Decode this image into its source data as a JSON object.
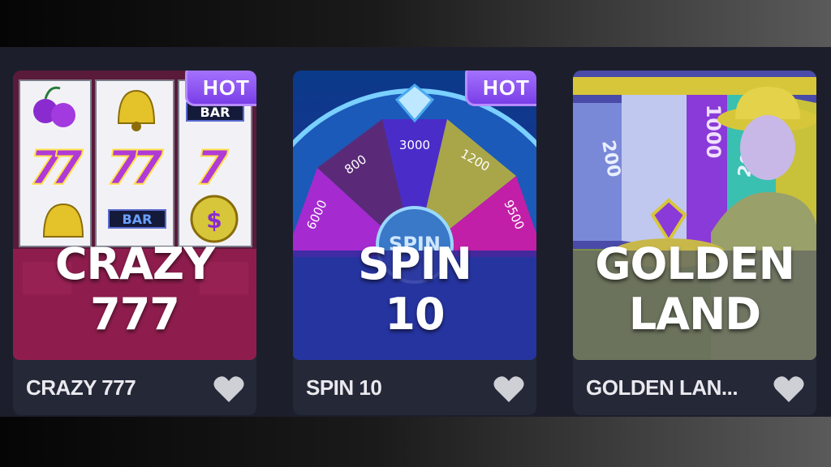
{
  "games": [
    {
      "title_line1": "CRAZY",
      "title_line2": "777",
      "caption": "CRAZY 777",
      "badge": "HOT",
      "reel_symbols": [
        "BAR",
        "BAR",
        "$"
      ]
    },
    {
      "title_line1": "SPIN",
      "title_line2": "10",
      "caption": "SPIN 10",
      "badge": "HOT",
      "wheel_values": [
        "3000",
        "1200",
        "9500",
        "800",
        "6000"
      ],
      "wheel_center": "SPIN"
    },
    {
      "title_line1": "GOLDEN",
      "title_line2": "LAND",
      "caption": "GOLDEN LAN...",
      "wheel_values": [
        "1000",
        "200",
        "200"
      ]
    }
  ],
  "colors": {
    "strip_bg": "#1c1f2b",
    "card_bg": "#242837",
    "hot_badge": "#8a4cf0",
    "crazy_bottom": "#8e1d4d",
    "spin_bottom": "#2a2c9a",
    "golden_bottom": "#6a6f60"
  },
  "icons": [
    "heart-icon",
    "cherry-icon",
    "bell-icon",
    "seven-icon",
    "diamond-icon"
  ]
}
